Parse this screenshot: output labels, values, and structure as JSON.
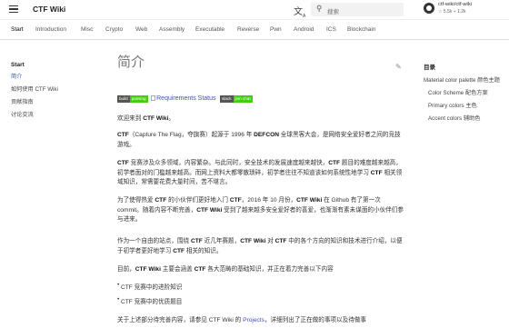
{
  "header": {
    "site_title": "CTF Wiki",
    "search_placeholder": "搜索",
    "repo_name": "ctf-wiki/ctf-wiki",
    "repo_stats": "☆ 5.5k   ⑂ 1.2k"
  },
  "tabs": [
    "Start",
    "Introduction",
    "Misc",
    "Crypto",
    "Web",
    "Assembly",
    "Executable",
    "Reverse",
    "Pwn",
    "Android",
    "ICS",
    "Blockchain"
  ],
  "nav": {
    "heading": "Start",
    "items": [
      "简介",
      "如何使用 CTF Wiki",
      "贡献指南",
      "讨论交流"
    ]
  },
  "main": {
    "title": "简介",
    "badges": {
      "build_label": "build",
      "build_status": "passing",
      "req_alt": "Requirements Status",
      "slack_label": "slack",
      "slack_status": "join chat"
    },
    "p1_before": "欢迎来到 ",
    "p1_bold": "CTF Wiki",
    "p1_after": "。",
    "p2_bold1": "CTF",
    "p2_mid1": "（Capture The Flag，夺旗赛）起源于 1996 年 ",
    "p2_bold2": "DEFCON",
    "p2_rest": " 全球黑客大会，是网络安全爱好者之间的竞技游戏。",
    "p3_bold": "CTF",
    "p3_a": " 竞赛涉及众多领域，内容繁杂。与此同时，安全技术的发展速度越来越快，",
    "p3_b": " 题目的难度越来越高，初学者面对的门槛越来越高。而网上资料大都零散琐碎，初学者往往不知道该如何系统性地学习 ",
    "p3_c": " 相关领域知识，常需要花费大量时间，苦不堪言。",
    "p4_a": "为了使得热爱 ",
    "p4_b": " 的小伙伴们更好地入门 ",
    "p4_c": "，2016 年 10 月份，",
    "p4_d": " 在 Github 有了第一次 commit。随着内容不断完善，",
    "p4_e": " 受到了越来越多安全爱好者的喜爱，也渐渐有素未谋面的小伙伴们参与进来。",
    "p5_a": "作为一个自由的站点，围绕 ",
    "p5_b": " 近几年赛题，",
    "p5_c": " 对 ",
    "p5_d": " 中的各个方向的知识和技术进行介绍，以便于初学者更好地学习 ",
    "p5_e": " 相关的知识。",
    "p6_a": "目前，",
    "p6_b": " 主要会涵盖 ",
    "p6_c": " 各大范畴的基础知识，并正在着力完善以下内容",
    "bullets": [
      "CTF 竞赛中的进阶知识",
      "CTF 竞赛中的优质题目"
    ],
    "p7_a": "关于上述部分待完善内容，请参见 CTF Wiki 的 ",
    "p7_link": "Projects",
    "p7_b": "，详细列出了正在做的事项以及待做事"
  },
  "toc": {
    "heading": "目录",
    "items": [
      "Material color palette 颜色主题",
      "Color Scheme 配色方案",
      "Primary colors 主色",
      "Accent colors 辅助色"
    ]
  },
  "colors": {
    "accent": "#3f51b5",
    "badge_green": "#44cc11",
    "badge_dark": "#555555"
  }
}
